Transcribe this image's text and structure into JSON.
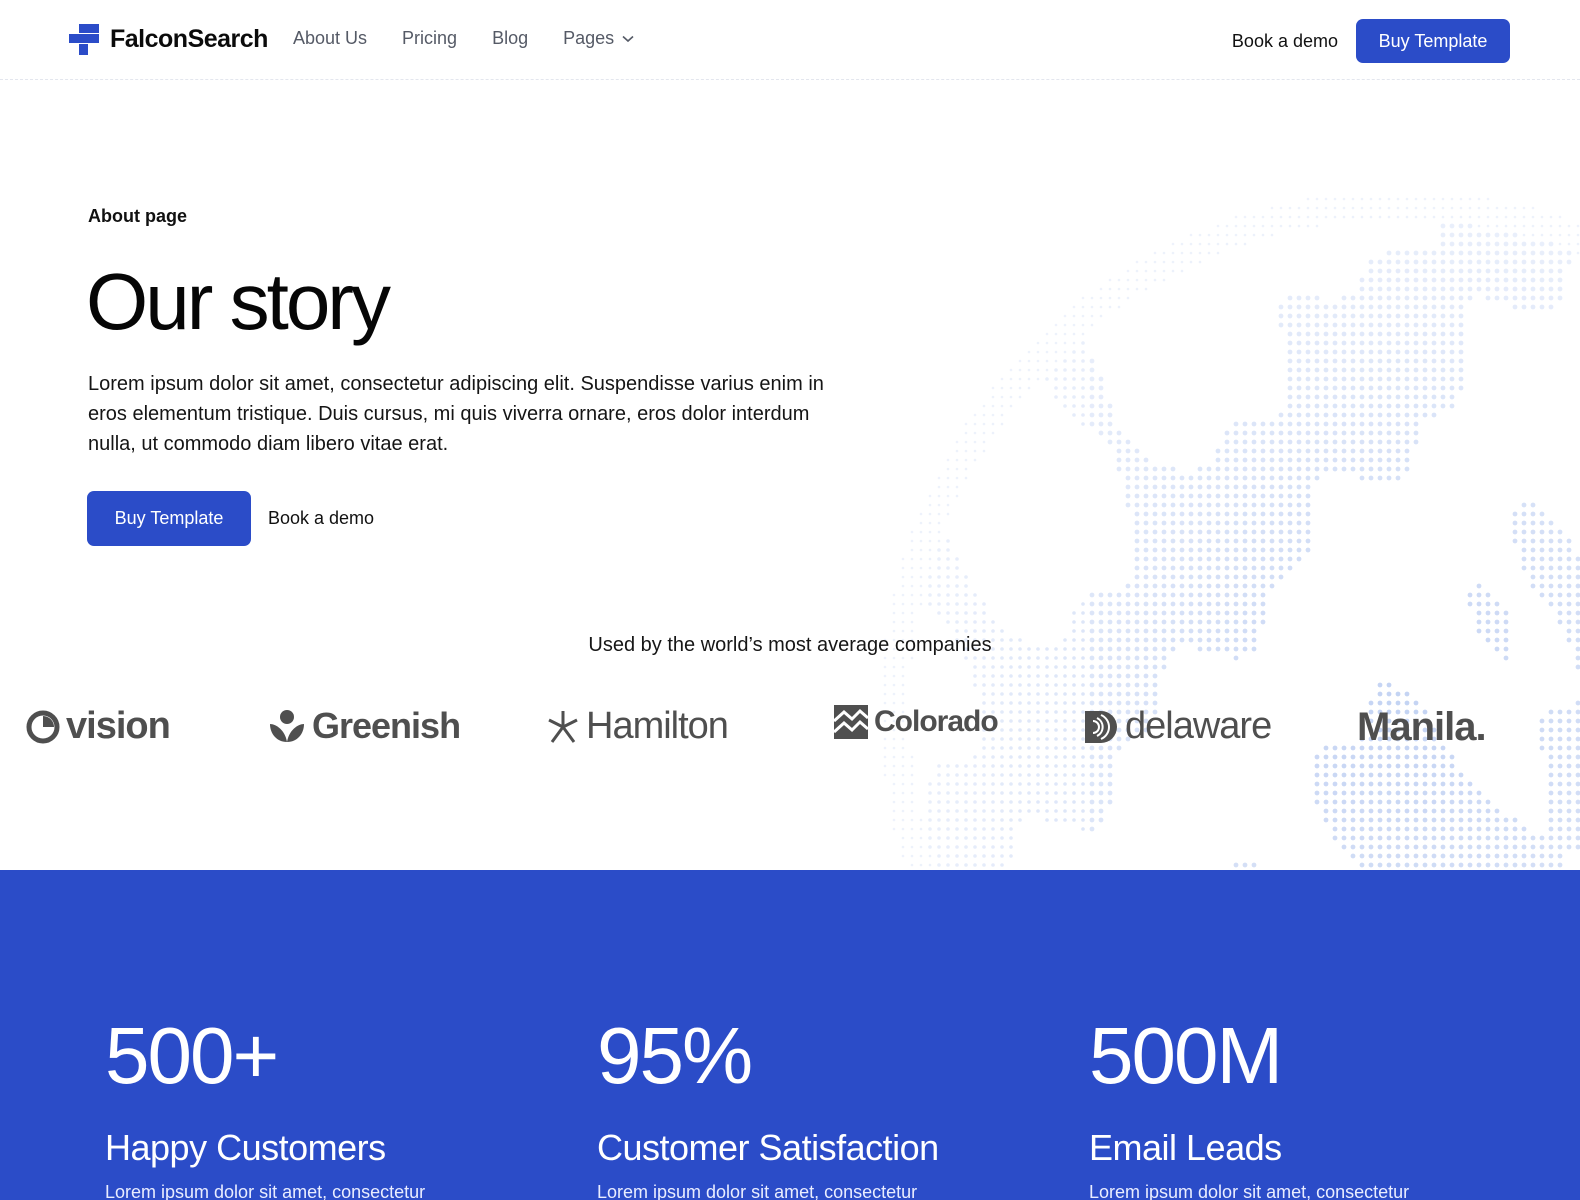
{
  "brand": {
    "name": "FalconSearch",
    "accent": "#2b4cc8"
  },
  "nav": {
    "links": [
      "About Us",
      "Pricing",
      "Blog",
      "Pages"
    ],
    "book_demo": "Book a demo",
    "buy": "Buy Template"
  },
  "hero": {
    "eyebrow": "About page",
    "title": "Our story",
    "text": "Lorem ipsum dolor sit amet, consectetur adipiscing elit. Suspendisse varius enim in eros elementum tristique. Duis cursus, mi quis viverra ornare, eros dolor interdum nulla, ut commodo diam libero vitae erat.",
    "buy": "Buy Template",
    "book_demo": "Book a demo"
  },
  "companies": {
    "heading": "Used by the world’s most average companies",
    "logos": [
      "vision",
      "Greenish",
      "Hamilton",
      "Colorado",
      "delaware",
      "Manila."
    ]
  },
  "stats": {
    "color": "#2b4cc8",
    "items": [
      {
        "value": "500+",
        "label": "Happy Customers",
        "text": "Lorem ipsum dolor sit amet, consectetur"
      },
      {
        "value": "95%",
        "label": "Customer Satisfaction",
        "text": "Lorem ipsum dolor sit amet, consectetur"
      },
      {
        "value": "500M",
        "label": "Email Leads",
        "text": "Lorem ipsum dolor sit amet, consectetur"
      }
    ]
  }
}
